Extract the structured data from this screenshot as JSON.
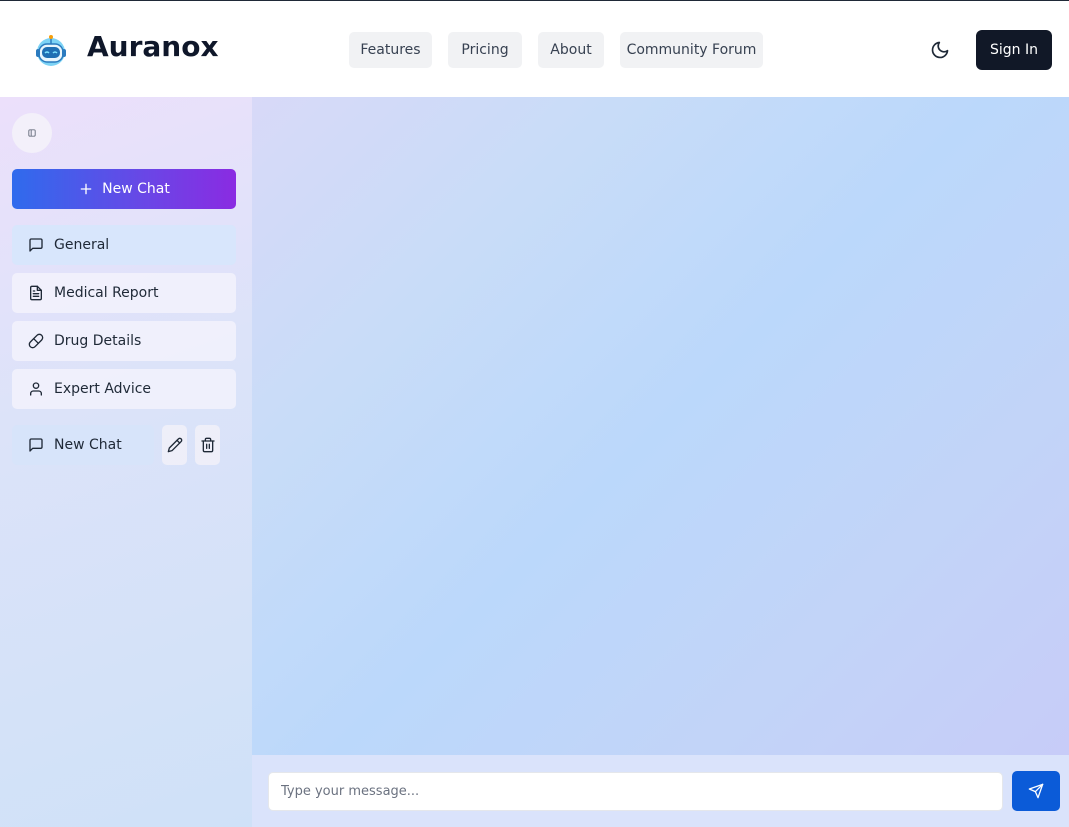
{
  "header": {
    "brand": "Auranox",
    "nav": [
      {
        "label": "Features"
      },
      {
        "label": "Pricing"
      },
      {
        "label": "About"
      },
      {
        "label": "Community Forum"
      }
    ],
    "theme_icon": "moon-icon",
    "sign_in_label": "Sign In"
  },
  "sidebar": {
    "collapse_icon": "sidebar-toggle-icon",
    "new_chat_label": "New Chat",
    "categories": [
      {
        "label": "General",
        "icon": "message-square-icon",
        "active": true
      },
      {
        "label": "Medical Report",
        "icon": "file-text-icon",
        "active": false
      },
      {
        "label": "Drug Details",
        "icon": "pill-icon",
        "active": false
      },
      {
        "label": "Expert Advice",
        "icon": "user-icon",
        "active": false
      }
    ],
    "chats": [
      {
        "label": "New Chat",
        "icon": "message-square-icon"
      }
    ]
  },
  "composer": {
    "placeholder": "Type your message...",
    "send_icon": "send-icon"
  },
  "colors": {
    "accent_gradient_start": "#2f6bed",
    "accent_gradient_end": "#8a2be2",
    "send_button": "#0b5bd8",
    "sign_in_bg": "#111827"
  }
}
